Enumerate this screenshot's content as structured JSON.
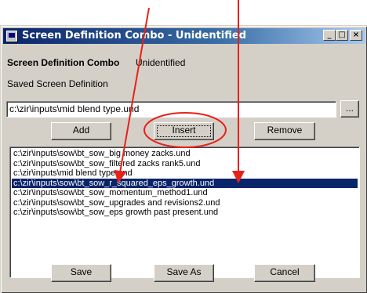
{
  "window": {
    "title": "Screen Definition Combo - Unidentified",
    "minimize_glyph": "_",
    "maximize_glyph": "□",
    "close_glyph": "×"
  },
  "form": {
    "heading_label": "Screen Definition Combo",
    "heading_value": "Unidentified",
    "saved_label": "Saved Screen Definition",
    "path_value": "c:\\zir\\inputs\\mid blend type.und",
    "browse_label": "..."
  },
  "buttons": {
    "add": "Add",
    "insert": "Insert",
    "remove": "Remove",
    "save": "Save",
    "save_as": "Save As",
    "cancel": "Cancel"
  },
  "list": {
    "items": [
      "c:\\zir\\inputs\\sow\\bt_sow_big money zacks.und",
      "c:\\zir\\inputs\\sow\\bt_sow_filtered zacks rank5.und",
      "c:\\zir\\inputs\\mid blend type.und",
      "c:\\zir\\inputs\\sow\\bt_sow_r_squared_eps_growth.und",
      "c:\\zir\\inputs\\sow\\bt_sow_momentum_method1.und",
      "c:\\zir\\inputs\\sow\\bt_sow_upgrades and revisions2.und",
      "c:\\zir\\inputs\\sow\\bt_sow_eps growth past present.und"
    ],
    "selected_index": 3
  },
  "colors": {
    "annotation": "#e8201a",
    "selection": "#0a246a",
    "face": "#d4d0c8"
  }
}
